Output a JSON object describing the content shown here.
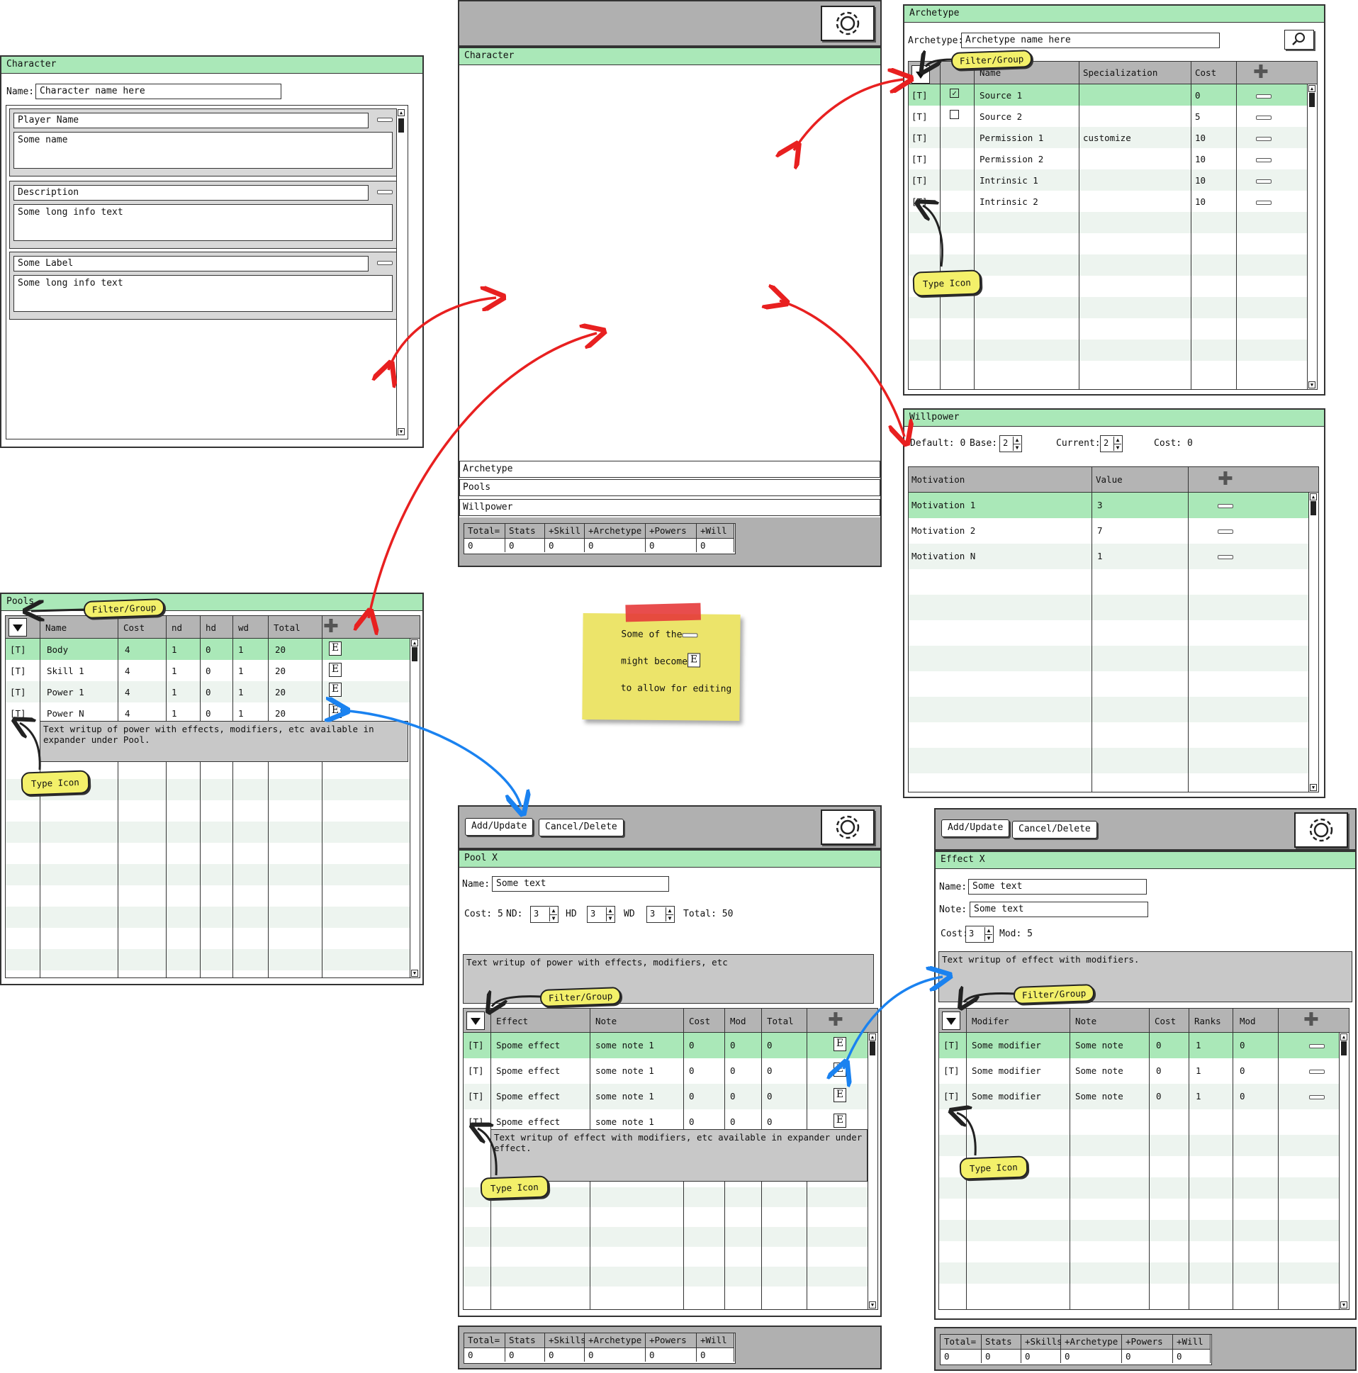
{
  "gear_icon": "gear-icon",
  "colors": {
    "title_green": "#aae8b8",
    "grid_header": "#b4b4b4",
    "toolbar_gray": "#b0b0b0",
    "note_yellow": "#ece46a",
    "tape_red": "#e53a3a",
    "tag_yellow": "#f3f06a",
    "arrow_red": "#e82020",
    "arrow_blue": "#1a82f0"
  },
  "character_panel": {
    "title": "Character",
    "name_label": "Name:",
    "name_value": "Character name here",
    "sections": [
      {
        "label": "Player Name",
        "text": "Some name"
      },
      {
        "label": "Description",
        "text": "Some long info text"
      },
      {
        "label": "Some Label",
        "text": "Some long info text"
      }
    ]
  },
  "main": {
    "title": "Character",
    "sections": [
      "Archetype",
      "Pools",
      "Willpower"
    ],
    "totals": {
      "headers": [
        "Total=",
        "Stats",
        "+Skill",
        "+Archetype",
        "+Powers",
        "+Will"
      ],
      "values": [
        "0",
        "0",
        "0",
        "0",
        "0",
        "0"
      ]
    }
  },
  "archetype": {
    "title": "Archetype",
    "label": "Archetype:",
    "value": "Archetype name here",
    "search_icon": "magnifier-icon",
    "filter_tag": "Filter/Group",
    "type_tag": "Type Icon",
    "columns": [
      "Name",
      "Specialization",
      "Cost"
    ],
    "rows": [
      {
        "t": "[T]",
        "checked": true,
        "name": "Source 1",
        "spec": "",
        "cost": "0"
      },
      {
        "t": "[T]",
        "checked": false,
        "name": "Source 2",
        "spec": "",
        "cost": "5"
      },
      {
        "t": "[T]",
        "name": "Permission 1",
        "spec": "customize",
        "cost": "10"
      },
      {
        "t": "[T]",
        "name": "Permission 2",
        "spec": "",
        "cost": "10"
      },
      {
        "t": "[T]",
        "name": "Intrinsic 1",
        "spec": "",
        "cost": "10"
      },
      {
        "t": "[T]",
        "name": "Intrinsic 2",
        "spec": "",
        "cost": "10"
      }
    ]
  },
  "willpower": {
    "title": "Willpower",
    "default_label": "Default: 0",
    "base_label": "Base:",
    "base_value": "2",
    "current_label": "Current:",
    "current_value": "2",
    "cost_label": "Cost: 0",
    "columns": [
      "Motivation",
      "Value"
    ],
    "rows": [
      {
        "name": "Motivation 1",
        "value": "3"
      },
      {
        "name": "Motivation 2",
        "value": "7"
      },
      {
        "name": "Motivation N",
        "value": "1"
      }
    ]
  },
  "pools": {
    "title": "Pools",
    "filter_tag": "Filter/Group",
    "type_tag": "Type Icon",
    "columns": [
      "Name",
      "Cost",
      "nd",
      "hd",
      "wd",
      "Total"
    ],
    "rows": [
      {
        "t": "[T]",
        "name": "Body",
        "cost": "4",
        "nd": "1",
        "hd": "0",
        "wd": "1",
        "total": "20"
      },
      {
        "t": "[T]",
        "name": "Skill 1",
        "cost": "4",
        "nd": "1",
        "hd": "0",
        "wd": "1",
        "total": "20"
      },
      {
        "t": "[T]",
        "name": "Power 1",
        "cost": "4",
        "nd": "1",
        "hd": "0",
        "wd": "1",
        "total": "20"
      },
      {
        "t": "[T]",
        "name": "Power N",
        "cost": "4",
        "nd": "1",
        "hd": "0",
        "wd": "1",
        "total": "20"
      }
    ],
    "expander": "Text writup of power with effects, modifiers, etc available in expander under Pool.",
    "edit_glyph": "E"
  },
  "note": {
    "line1": "Some of the",
    "line2": "might become",
    "line3": "to allow for editing",
    "edit_glyph": "E"
  },
  "pool_x": {
    "add": "Add/Update",
    "cancel": "Cancel/Delete",
    "title": "Pool X",
    "name_label": "Name:",
    "name_value": "Some text",
    "cost_label": "Cost: 5",
    "nd_label": "ND:",
    "nd_value": "3",
    "hd_label": "HD",
    "hd_value": "3",
    "wd_label": "WD",
    "wd_value": "3",
    "total_label": "Total: 50",
    "writeup": "Text writup of power with effects, modifiers, etc",
    "filter_tag": "Filter/Group",
    "type_tag": "Type Icon",
    "columns": [
      "Effect",
      "Note",
      "Cost",
      "Mod",
      "Total"
    ],
    "rows": [
      {
        "t": "[T]",
        "effect": "Spome effect",
        "note": "some note 1",
        "cost": "0",
        "mod": "0",
        "total": "0"
      },
      {
        "t": "[T]",
        "effect": "Spome effect",
        "note": "some note 1",
        "cost": "0",
        "mod": "0",
        "total": "0"
      },
      {
        "t": "[T]",
        "effect": "Spome effect",
        "note": "some note 1",
        "cost": "0",
        "mod": "0",
        "total": "0"
      },
      {
        "t": "[T]",
        "effect": "Spome effect",
        "note": "some note 1",
        "cost": "0",
        "mod": "0",
        "total": "0"
      }
    ],
    "expander": "Text writup of effect with modifiers, etc available in expander under effect.",
    "totals": {
      "headers": [
        "Total=",
        "Stats",
        "+Skills",
        "+Archetype",
        "+Powers",
        "+Will"
      ],
      "values": [
        "0",
        "0",
        "0",
        "0",
        "0",
        "0"
      ]
    }
  },
  "effect_x": {
    "add": "Add/Update",
    "cancel": "Cancel/Delete",
    "title": "Effect X",
    "name_label": "Name:",
    "name_value": "Some text",
    "note_label": "Note:",
    "note_value": "Some text",
    "cost_label": "Cost:",
    "cost_value": "3",
    "mod_label": "Mod: 5",
    "writeup": "Text writup of effect with modifiers.",
    "filter_tag": "Filter/Group",
    "type_tag": "Type Icon",
    "columns": [
      "Modifer",
      "Note",
      "Cost",
      "Ranks",
      "Mod"
    ],
    "rows": [
      {
        "t": "[T]",
        "name": "Some modifier",
        "note": "Some note",
        "cost": "0",
        "ranks": "1",
        "mod": "0"
      },
      {
        "t": "[T]",
        "name": "Some modifier",
        "note": "Some note",
        "cost": "0",
        "ranks": "1",
        "mod": "0"
      },
      {
        "t": "[T]",
        "name": "Some modifier",
        "note": "Some note",
        "cost": "0",
        "ranks": "1",
        "mod": "0"
      }
    ],
    "totals": {
      "headers": [
        "Total=",
        "Stats",
        "+Skills",
        "+Archetype",
        "+Powers",
        "+Will"
      ],
      "values": [
        "0",
        "0",
        "0",
        "0",
        "0",
        "0"
      ]
    }
  }
}
